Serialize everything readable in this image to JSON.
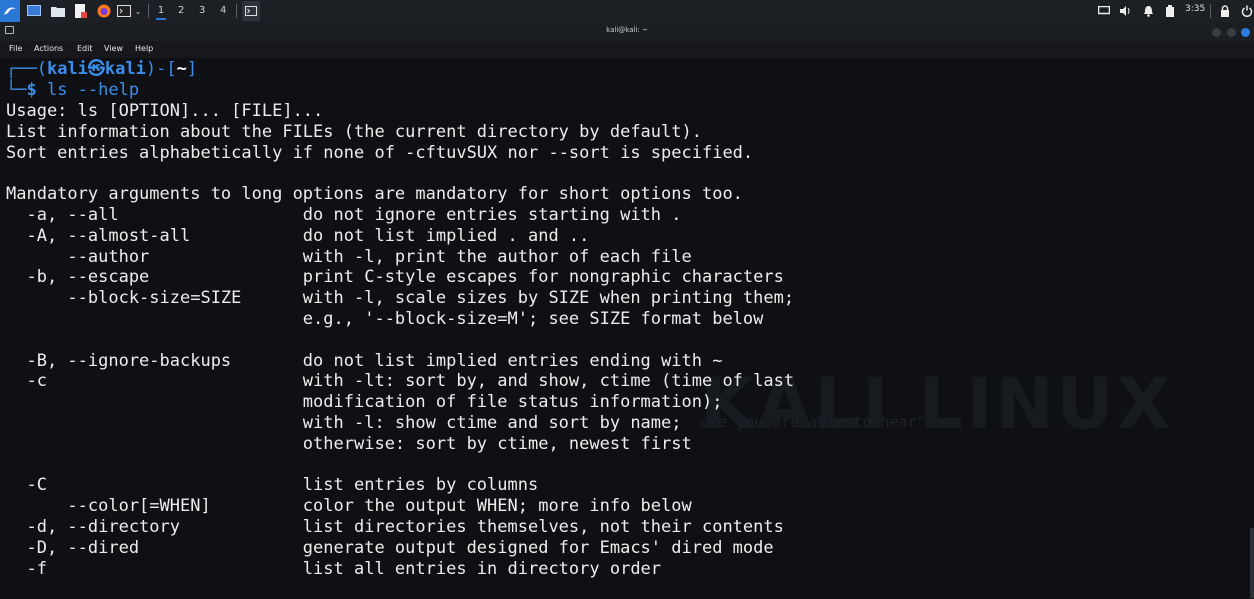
{
  "panel": {
    "workspaces": [
      "1",
      "2",
      "3",
      "4"
    ],
    "time": "3:35"
  },
  "window": {
    "title": "kali@kali: ~",
    "menu": [
      "File",
      "Actions",
      "Edit",
      "View",
      "Help"
    ]
  },
  "watermark": {
    "text": "KALI LINUX",
    "quote": "ore you are able to hear\""
  },
  "terminal": {
    "prompt_top_open": "┌──(",
    "prompt_user": "kali㉿kali",
    "prompt_top_close": ")-[",
    "prompt_dir": "~",
    "prompt_top_end": "]",
    "prompt_bottom": "└─",
    "prompt_dollar": "$",
    "command": " ls --help",
    "output": [
      "Usage: ls [OPTION]... [FILE]...",
      "List information about the FILEs (the current directory by default).",
      "Sort entries alphabetically if none of -cftuvSUX nor --sort is specified.",
      "",
      "Mandatory arguments to long options are mandatory for short options too.",
      "  -a, --all                  do not ignore entries starting with .",
      "  -A, --almost-all           do not list implied . and ..",
      "      --author               with -l, print the author of each file",
      "  -b, --escape               print C-style escapes for nongraphic characters",
      "      --block-size=SIZE      with -l, scale sizes by SIZE when printing them;",
      "                             e.g., '--block-size=M'; see SIZE format below",
      "",
      "  -B, --ignore-backups       do not list implied entries ending with ~",
      "  -c                         with -lt: sort by, and show, ctime (time of last",
      "                             modification of file status information);",
      "                             with -l: show ctime and sort by name;",
      "                             otherwise: sort by ctime, newest first",
      "",
      "  -C                         list entries by columns",
      "      --color[=WHEN]         color the output WHEN; more info below",
      "  -d, --directory            list directories themselves, not their contents",
      "  -D, --dired                generate output designed for Emacs' dired mode",
      "  -f                         list all entries in directory order"
    ]
  }
}
